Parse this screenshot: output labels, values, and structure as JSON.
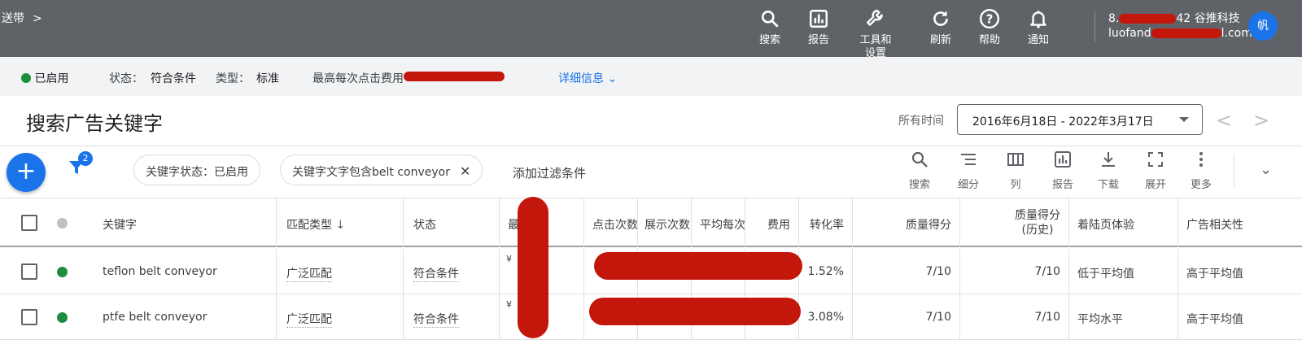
{
  "topbar": {
    "breadcrumb": "送带",
    "tools": {
      "search": "搜索",
      "reports": "报告",
      "tools_settings_1": "工具和",
      "tools_settings_2": "设置",
      "refresh": "刷新",
      "help": "帮助",
      "notifications": "通知"
    },
    "account_line1_prefix": "8.",
    "account_line1_suffix": "42 谷推科技",
    "account_line2_prefix": "luofand",
    "account_line2_suffix": "l.com",
    "avatar_text": "帆"
  },
  "statusbar": {
    "enabled": "已启用",
    "status_label": "状态：",
    "status_value": "符合条件",
    "type_label": "类型：",
    "type_value": "标准",
    "max_cpc_label": "最高每次点击费用",
    "details_link": "详细信息"
  },
  "title": {
    "page_title": "搜索广告关键字",
    "all_time": "所有时间",
    "date_range": "2016年6月18日 - 2022年3月17日"
  },
  "filters": {
    "badge_count": "2",
    "chip1": "关键字状态：已启用",
    "chip2": "关键字文字包含belt conveyor",
    "add_filter": "添加过滤条件"
  },
  "toolbar": {
    "search": "搜索",
    "segment": "细分",
    "columns": "列",
    "reports": "报告",
    "download": "下载",
    "expand": "展开",
    "more": "更多"
  },
  "table": {
    "headers": {
      "keyword": "关键字",
      "match_type": "匹配类型",
      "status": "状态",
      "max_cpc": "最",
      "clicks": "点击次数",
      "impressions": "展示次数",
      "avg_cpc": "平均每次",
      "cost": "费用",
      "conv_rate": "转化率",
      "quality_score": "质量得分",
      "quality_score_hist_1": "质量得分",
      "quality_score_hist_2": "(历史)",
      "landing_page": "着陆页体验",
      "ad_relevance": "广告相关性"
    },
    "rows": [
      {
        "keyword": "teflon belt conveyor",
        "match_type": "广泛匹配",
        "status": "符合条件",
        "max_cpc_symbol": "¥",
        "conv_rate": "1.52%",
        "quality_score": "7/10",
        "quality_score_hist": "7/10",
        "landing_page": "低于平均值",
        "ad_relevance": "高于平均值"
      },
      {
        "keyword": "ptfe belt conveyor",
        "match_type": "广泛匹配",
        "status": "符合条件",
        "max_cpc_symbol": "¥",
        "conv_rate": "3.08%",
        "quality_score": "7/10",
        "quality_score_hist": "7/10",
        "landing_page": "平均水平",
        "ad_relevance": "高于平均值"
      }
    ]
  },
  "colors": {
    "topbar": "#5f6368",
    "accent": "#1a73e8",
    "enabled_dot": "#1e8e3e",
    "redaction": "#c4170c"
  }
}
